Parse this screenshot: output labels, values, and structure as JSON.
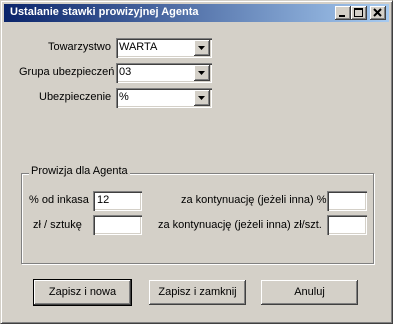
{
  "window": {
    "title": "Ustalanie stawki prowizyjnej Agenta"
  },
  "titlebar_buttons": {
    "minimize": "minimize-icon",
    "maximize": "maximize-icon",
    "close": "close-icon"
  },
  "form": {
    "towarzystwo": {
      "label": "Towarzystwo",
      "value": "WARTA"
    },
    "grupa": {
      "label": "Grupa ubezpieczeń",
      "value": "03"
    },
    "ubezpieczenie": {
      "label": "Ubezpieczenie",
      "value": "%"
    }
  },
  "prowizja": {
    "title": "Prowizja dla Agenta",
    "od_inkasa_label": "% od inkasa",
    "od_inkasa_value": "12",
    "zl_sztuke_label": "zł / sztukę",
    "zl_sztuke_value": "",
    "kontynuacja_pct_label": "za kontynuację (jeżeli inna) %",
    "kontynuacja_pct_value": "",
    "kontynuacja_zl_label": "za kontynuację (jeżeli inna) zł/szt.",
    "kontynuacja_zl_value": ""
  },
  "buttons": {
    "save_new": "Zapisz i nowa",
    "save_close": "Zapisz i zamknij",
    "cancel": "Anuluj"
  }
}
